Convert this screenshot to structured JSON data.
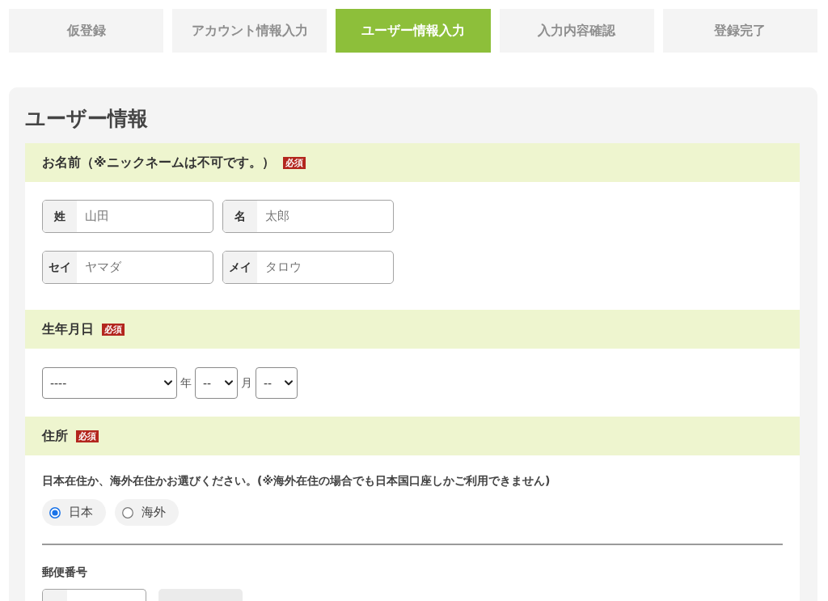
{
  "steps": [
    {
      "label": "仮登録",
      "selected": false
    },
    {
      "label": "アカウント情報入力",
      "selected": false
    },
    {
      "label": "ユーザー情報入力",
      "selected": true
    },
    {
      "label": "入力内容確認",
      "selected": false
    },
    {
      "label": "登録完了",
      "selected": false
    }
  ],
  "form": {
    "title": "ユーザー情報",
    "sections": [
      {
        "kind": "name",
        "heading": "お名前（※ニックネームは不可です。）",
        "badge": "必須",
        "rows": [
          [
            {
              "label": "姓",
              "placeholder": "山田"
            },
            {
              "label": "名",
              "placeholder": "太郎"
            }
          ],
          [
            {
              "label": "セイ",
              "placeholder": "ヤマダ"
            },
            {
              "label": "メイ",
              "placeholder": "タロウ"
            }
          ]
        ]
      },
      {
        "kind": "date",
        "heading": "生年月日",
        "badge": "必須",
        "selects": [
          {
            "value": "----",
            "unit": "年"
          },
          {
            "value": "--",
            "unit": "月"
          },
          {
            "value": "--"
          }
        ]
      },
      {
        "kind": "address",
        "heading": "住所",
        "badge": "必須",
        "note": "日本在住か、海外在住かお選びください。(※海外在住の場合でも日本国口座しかご利用できません)",
        "options": [
          {
            "label": "日本",
            "selected": true
          },
          {
            "label": "海外",
            "selected": false
          }
        ],
        "postal": {
          "label": "郵便番号"
        }
      }
    ]
  }
}
